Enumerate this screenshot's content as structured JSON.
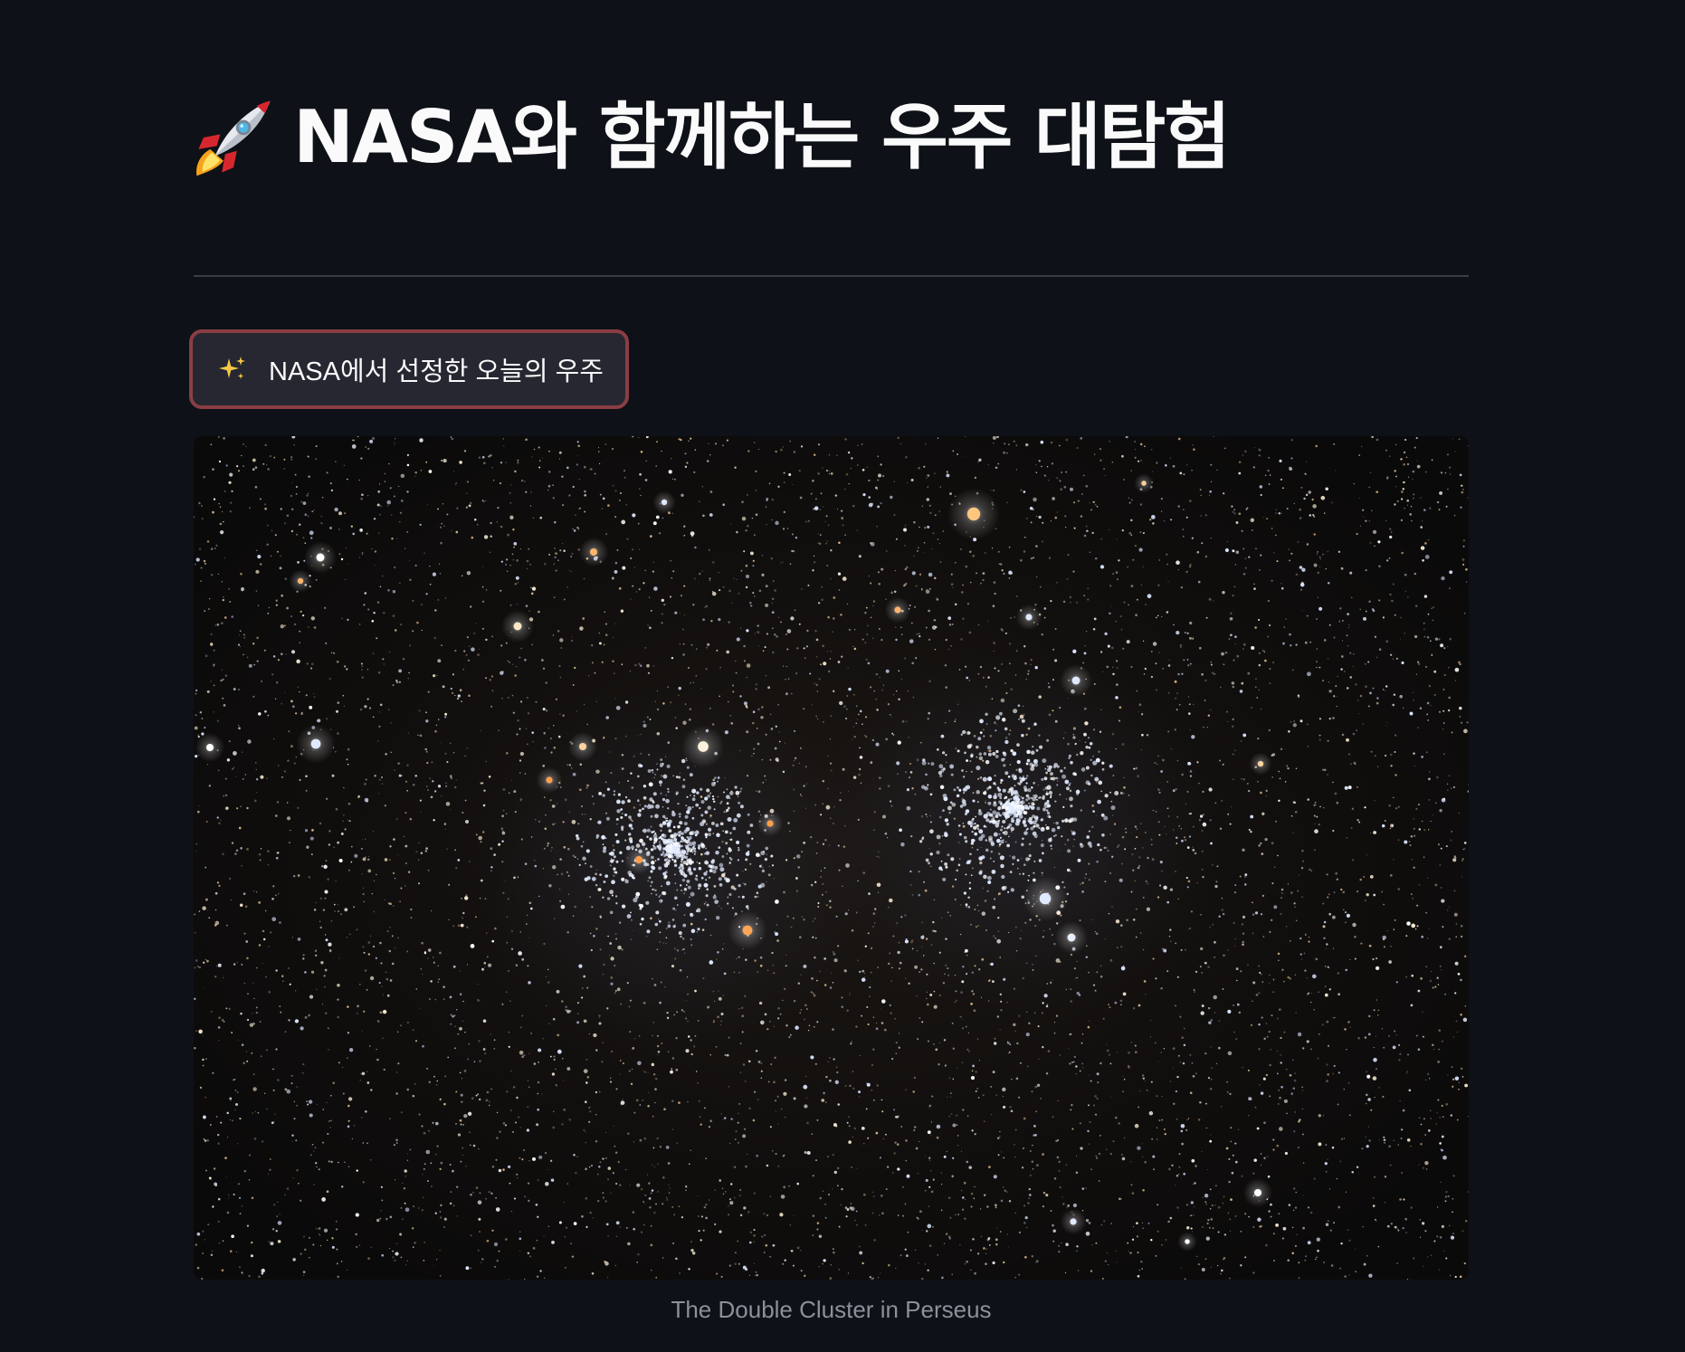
{
  "header": {
    "title": "NASA와 함께하는 우주 대탐험",
    "title_icon": "rocket-icon"
  },
  "apod_button": {
    "label": "NASA에서 선정한 오늘의 우주",
    "icon": "sparkles-icon",
    "border_color": "#8a3e44"
  },
  "apod": {
    "caption": "The Double Cluster in Perseus"
  },
  "colors": {
    "background": "#0e1117",
    "text": "#fafafa",
    "button_bg": "#262730",
    "caption": "#8d9099"
  }
}
